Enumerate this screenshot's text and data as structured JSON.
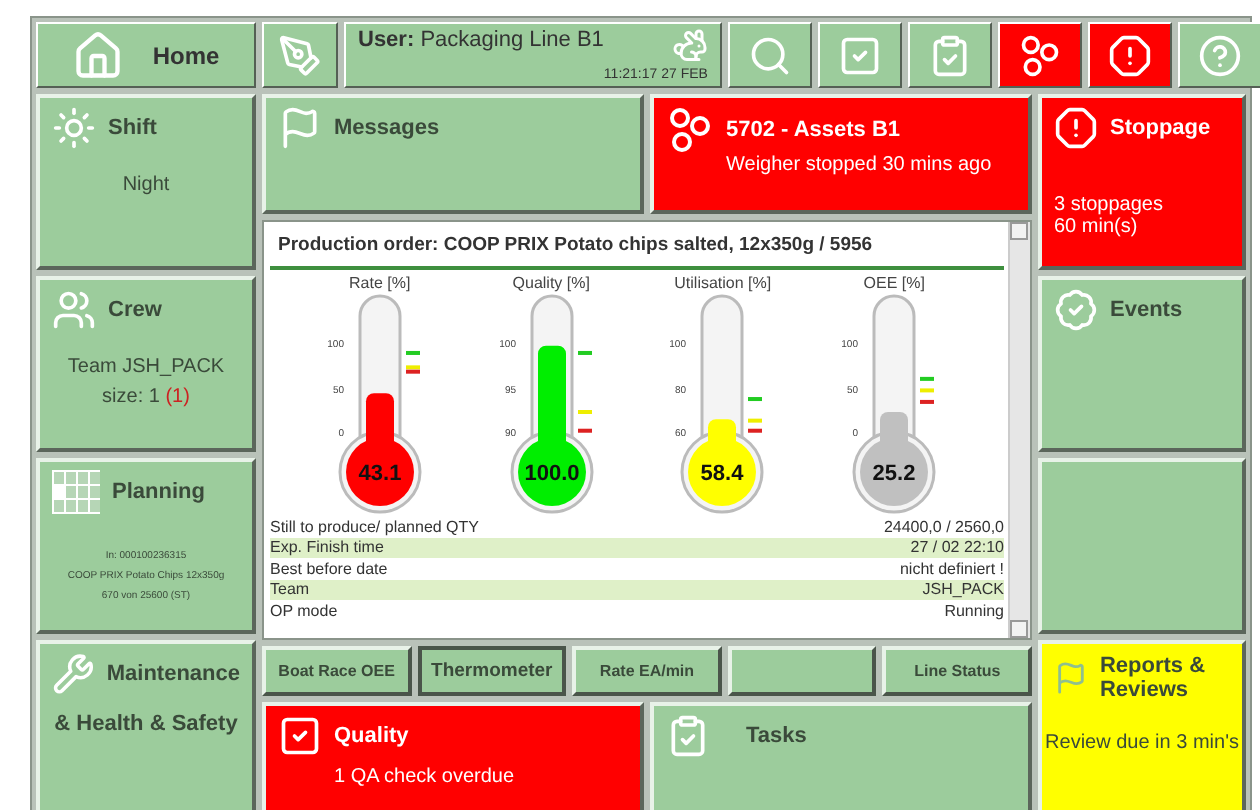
{
  "top_bar": {
    "home": {
      "label": "Home"
    },
    "user": {
      "label": "User:",
      "name": "Packaging Line B1",
      "time": "11:21:17",
      "date": "27  FEB"
    },
    "tools": [
      {
        "kind": "search",
        "color": "#9ccc9c"
      },
      {
        "kind": "check",
        "color": "#9ccc9c"
      },
      {
        "kind": "clipboard",
        "color": "#9ccc9c"
      },
      {
        "kind": "assets",
        "color": "#ff0000"
      },
      {
        "kind": "alert",
        "color": "#ff0000"
      },
      {
        "kind": "help",
        "color": "#9ccc9c"
      }
    ]
  },
  "left_tiles": [
    {
      "kind": "shift",
      "color": "#9ccc9c",
      "title": "Shift",
      "lines": [
        "Night"
      ]
    },
    {
      "kind": "crew",
      "color": "#9ccc9c",
      "title": "Crew",
      "lines": [
        "Team JSH_PACK"
      ],
      "size": "size: 1",
      "size_alert": "(1)"
    },
    {
      "kind": "planning",
      "color": "#9ccc9c",
      "title": "Planning",
      "small_lines": [
        "In: 000100236315",
        "COOP PRIX Potato Chips 12x350g",
        "670 von 25600 (ST)"
      ]
    },
    {
      "kind": "maintenance",
      "color": "#9ccc9c",
      "title": "Maintenance",
      "subtitle": "& Health & Safety"
    }
  ],
  "messages": {
    "title": "Messages",
    "color": "#9ccc9c"
  },
  "assets": {
    "title": "5702 -  Assets B1",
    "message": "Weigher stopped 30 mins ago",
    "color": "#ff0000"
  },
  "production": {
    "title": "Production order: COOP PRIX Potato chips salted, 12x350g  / 5956",
    "gauges": [
      {
        "label": "Rate [%]",
        "value": "43.1",
        "color": "#ff0000",
        "ticks": [
          "100",
          "50",
          "0"
        ],
        "marks": [
          {
            "color": "#22cc22"
          },
          {
            "color": "#eeee00"
          },
          {
            "color": "#dd2222"
          }
        ]
      },
      {
        "label": "Quality [%]",
        "value": "100.0",
        "color": "#00ee00",
        "ticks": [
          "100",
          "95",
          "90"
        ],
        "marks": [
          {
            "color": "#22cc22"
          },
          {
            "color": "#eeee00"
          },
          {
            "color": "#dd2222"
          }
        ]
      },
      {
        "label": "Utilisation [%]",
        "value": "58.4",
        "color": "#ffff00",
        "ticks": [
          "100",
          "80",
          "60"
        ],
        "marks": [
          {
            "color": "#22cc22"
          },
          {
            "color": "#eeee00"
          },
          {
            "color": "#dd2222"
          }
        ]
      },
      {
        "label": "OEE [%]",
        "value": "25.2",
        "color": "#c0c0c0",
        "ticks": [
          "100",
          "50",
          "0"
        ],
        "marks": [
          {
            "color": "#22cc22"
          },
          {
            "color": "#eeee00"
          },
          {
            "color": "#dd2222"
          }
        ]
      }
    ],
    "info_rows": [
      {
        "label": "Still to produce/ planned QTY",
        "value": "24400,0 / 2560,0"
      },
      {
        "label": "Exp. Finish time",
        "value": "27 / 02  22:10"
      },
      {
        "label": "Best before date",
        "value": "nicht definiert !"
      },
      {
        "label": "Team",
        "value": "JSH_PACK"
      },
      {
        "label": "OP mode",
        "value": "Running"
      }
    ]
  },
  "tabs": [
    {
      "label": "Boat Race OEE",
      "selected": false
    },
    {
      "label": "Thermometer",
      "selected": true
    },
    {
      "label": "Rate EA/min",
      "selected": false
    },
    {
      "selected": false
    },
    {
      "label": "Line Status",
      "selected": false
    }
  ],
  "quality": {
    "title": "Quality",
    "message": "1 QA check overdue",
    "color": "#ff0000"
  },
  "tasks": {
    "title": "Tasks",
    "color": "#9ccc9c"
  },
  "right_tiles": [
    {
      "kind": "stoppage",
      "color": "#ff0000",
      "title": "Stoppage",
      "lines": [
        "3 stoppages",
        "60 min(s)"
      ]
    },
    {
      "kind": "events",
      "color": "#9ccc9c",
      "title": "Events"
    },
    {
      "kind": "blank",
      "color": "#9ccc9c"
    },
    {
      "kind": "reports",
      "color": "#ffff00",
      "title": "Reports & Reviews",
      "message": "Review due in 3 min's"
    }
  ]
}
